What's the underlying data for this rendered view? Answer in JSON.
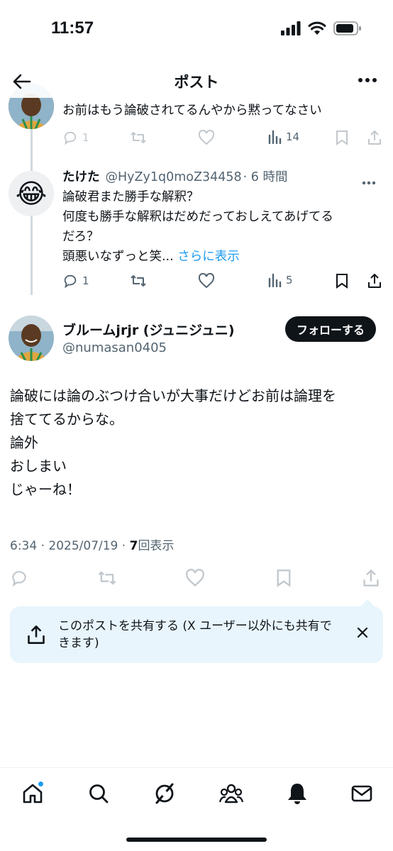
{
  "status_bar": {
    "time": "11:57"
  },
  "header": {
    "title": "ポスト"
  },
  "previous_reply": {
    "text": "お前はもう論破されてるんやから黙ってなさい",
    "replies": "1",
    "retweets": "",
    "likes": "",
    "views": "14"
  },
  "reply": {
    "name": "たけた",
    "handle": "@HyZy1q0moZ34458",
    "time": "· 6 時間",
    "lines": [
      "論破君また勝手な解釈？",
      "何度も勝手な解釈はだめだっておしえてあげてる",
      "だろ？",
      "頭悪いなずっと笑..."
    ],
    "show_more": "さらに表示",
    "replies": "1",
    "views": "5",
    "avatar_emoji": "😂"
  },
  "main_post": {
    "name": "ブルームjrjr (ジュニジュニ)",
    "handle": "@numasan0405",
    "follow_label": "フォローする",
    "lines": [
      "論破には論のぶつけ合いが大事だけどお前は論理を",
      "捨ててるからな。",
      "論外",
      "おしまい",
      "じゃーね！"
    ],
    "time_date": "6:34 · 2025/07/19 · ",
    "view_count": "7",
    "view_label": "回表示"
  },
  "share_banner": {
    "text": "このポストを共有する (X ユーザー以外にも共有できます)"
  },
  "colors": {
    "accent": "#1d9bf0",
    "text": "#0f1419",
    "secondary": "#536471",
    "banner": "#e8f5fd"
  },
  "nav": [
    "home-icon",
    "search-icon",
    "grok-icon",
    "communities-icon",
    "notifications-icon",
    "messages-icon"
  ]
}
